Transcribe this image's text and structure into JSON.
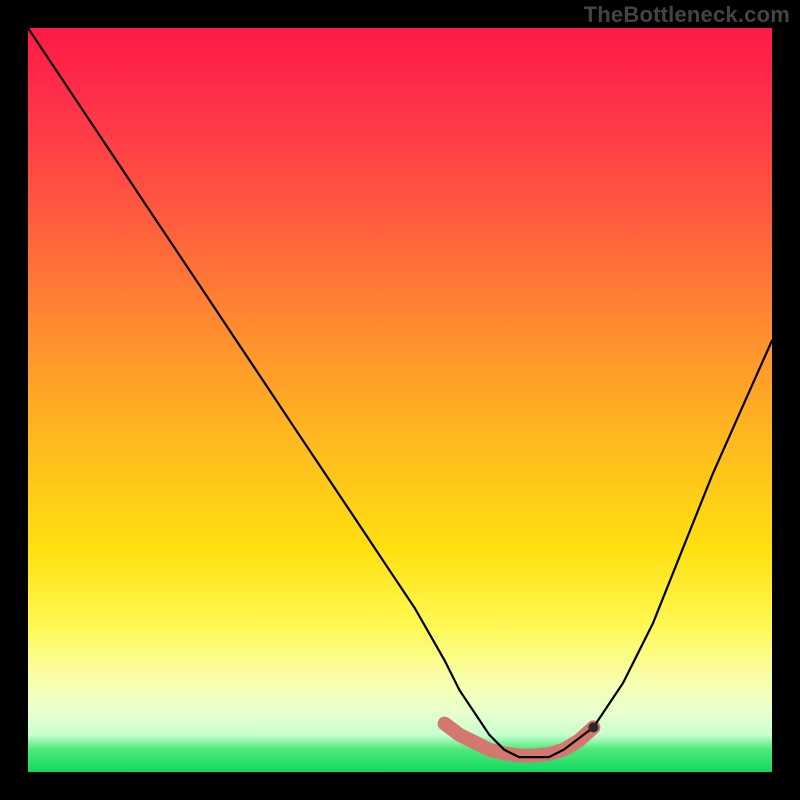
{
  "watermark": "TheBottleneck.com",
  "chart_data": {
    "type": "line",
    "title": "",
    "xlabel": "",
    "ylabel": "",
    "xlim": [
      0,
      100
    ],
    "ylim": [
      0,
      100
    ],
    "grid": false,
    "legend": false,
    "series": [
      {
        "name": "bottleneck-curve",
        "x": [
          0,
          4,
          8,
          12,
          16,
          20,
          24,
          28,
          32,
          36,
          40,
          44,
          48,
          52,
          56,
          58,
          60,
          62,
          64,
          66,
          68,
          70,
          72,
          76,
          80,
          84,
          88,
          92,
          96,
          100
        ],
        "y": [
          100,
          94,
          88,
          82,
          76,
          70,
          64,
          58,
          52,
          46,
          40,
          34,
          28,
          22,
          15,
          11,
          8,
          5,
          3,
          2,
          2,
          2,
          3,
          6,
          12,
          20,
          30,
          40,
          49,
          58
        ]
      }
    ],
    "highlight_band": {
      "name": "optimal-range",
      "x": [
        56,
        58,
        60,
        62,
        64,
        66,
        68,
        70,
        72,
        74,
        76
      ],
      "y": [
        6.5,
        5,
        4,
        3,
        2.5,
        2.2,
        2.2,
        2.4,
        3,
        4.2,
        6
      ]
    },
    "marker": {
      "name": "current-point",
      "x": 76,
      "y": 6
    },
    "gradient_stops": [
      {
        "pos": 0,
        "color": "#ff1a47"
      },
      {
        "pos": 25,
        "color": "#ff5a3e"
      },
      {
        "pos": 55,
        "color": "#ffb81f"
      },
      {
        "pos": 80,
        "color": "#fff850"
      },
      {
        "pos": 95,
        "color": "#c7ffcf"
      },
      {
        "pos": 100,
        "color": "#14d862"
      }
    ]
  }
}
